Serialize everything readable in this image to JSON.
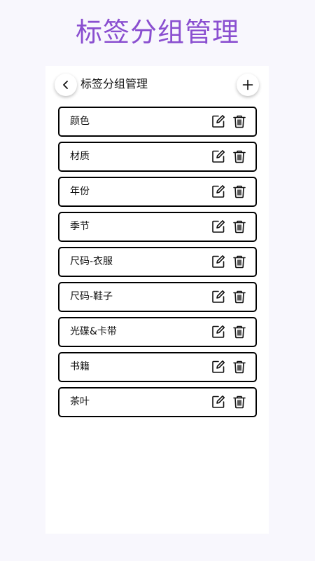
{
  "page": {
    "title": "标签分组管理"
  },
  "header": {
    "title": "标签分组管理",
    "back_icon": "chevron-left-icon",
    "add_icon": "plus-icon"
  },
  "tag_groups": [
    {
      "name": "颜色"
    },
    {
      "name": "材质"
    },
    {
      "name": "年份"
    },
    {
      "name": "季节"
    },
    {
      "name": "尺码-衣服"
    },
    {
      "name": "尺码-鞋子"
    },
    {
      "name": "光碟&卡带"
    },
    {
      "name": "书籍"
    },
    {
      "name": "茶叶"
    }
  ],
  "row_icons": {
    "edit": "edit-icon",
    "delete": "trash-icon"
  },
  "colors": {
    "title_accent": "#8a4fd0",
    "background": "#f8f7fd",
    "card": "#ffffff",
    "border": "#000000"
  }
}
